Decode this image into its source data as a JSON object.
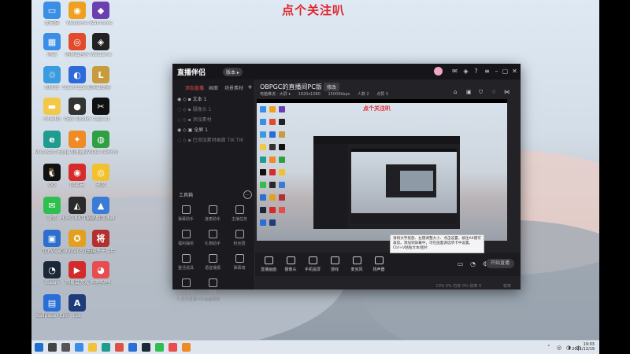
{
  "banner": "点个关注叭",
  "desktop_icons": [
    {
      "label": "此电脑",
      "color": "#3a8ee6",
      "glyph": "▭"
    },
    {
      "label": "WeGame",
      "color": "#f0a020",
      "glyph": "◉"
    },
    {
      "label": "Warframe",
      "color": "#6b3fb0",
      "glyph": "◆"
    },
    {
      "label": "网络",
      "color": "#3a8ee6",
      "glyph": "▦"
    },
    {
      "label": "网易云音乐",
      "color": "#e24a2b",
      "glyph": "◎"
    },
    {
      "label": "WeGame",
      "color": "#222",
      "glyph": "◈"
    },
    {
      "label": "回收站",
      "color": "#3a9be0",
      "glyph": "♲"
    },
    {
      "label": "SteamSpeed",
      "color": "#2f6bd8",
      "glyph": "◐"
    },
    {
      "label": "英雄联盟",
      "color": "#c89b3c",
      "glyph": "L"
    },
    {
      "label": "mhwlib",
      "color": "#f3c84a",
      "glyph": "▬"
    },
    {
      "label": "OBS Studio",
      "color": "#333",
      "glyph": "●"
    },
    {
      "label": "CapCut",
      "color": "#111",
      "glyph": "✂"
    },
    {
      "label": "Microsoft Edge",
      "color": "#1f9c8f",
      "glyph": "e"
    },
    {
      "label": "加速器",
      "color": "#f08a24",
      "glyph": "✦"
    },
    {
      "label": "NVIDIA GeForce",
      "color": "#2ea043",
      "glyph": "◍"
    },
    {
      "label": "QQ",
      "color": "#111",
      "glyph": "🐧"
    },
    {
      "label": "网易云",
      "color": "#d62b2b",
      "glyph": "◉"
    },
    {
      "label": "迅游",
      "color": "#f2c12e",
      "glyph": "◎"
    },
    {
      "label": "微信",
      "color": "#2fbf4f",
      "glyph": "✉"
    },
    {
      "label": "PUBG BATTLEGR...",
      "color": "#2a2a2a",
      "glyph": "◭"
    },
    {
      "label": "Win版加速器",
      "color": "#3a7bd5",
      "glyph": "▲"
    },
    {
      "label": "TCPView",
      "color": "#2d6fcf",
      "glyph": "▣"
    },
    {
      "label": "Counter-Strike Global Off...",
      "color": "#e2a020",
      "glyph": "✪"
    },
    {
      "label": "三国杀十周年",
      "color": "#b23030",
      "glyph": "将"
    },
    {
      "label": "Steam",
      "color": "#1b2838",
      "glyph": "◔"
    },
    {
      "label": "网易云游戏",
      "color": "#d32a2a",
      "glyph": "▶"
    },
    {
      "label": "哔哩哔哩",
      "color": "#e84c50",
      "glyph": "◕"
    },
    {
      "label": "Wallpaper Engine",
      "color": "#2a6fd6",
      "glyph": "▤"
    },
    {
      "label": "LoL",
      "color": "#1f3c7a",
      "glyph": "A"
    }
  ],
  "app": {
    "logo": "直播伴侣",
    "version": "版本 ▸",
    "left_tabs": [
      "添加直播",
      "画面",
      "场景素材"
    ],
    "sources": [
      {
        "name": "文本 1",
        "state": "visible"
      },
      {
        "name": "摄像头 1",
        "state": "hidden"
      },
      {
        "name": "添加素材",
        "state": "hidden"
      },
      {
        "name": "全屏 1",
        "state": "visible"
      },
      {
        "name": "已添加素材画面 TIK TIK",
        "state": "hidden"
      }
    ],
    "tools_header": "工具箱",
    "tools": [
      "弹幕助手",
      "连麦助手",
      "主播任务",
      "福利抽奖",
      "礼物助手",
      "粉丝团",
      "整活道具",
      "语音播报",
      "弹幕墙",
      "表情播报",
      "更多"
    ],
    "bottom_note": "5.显示直播中的画面模板",
    "room_title": "OBPGC的直播间PC版",
    "room_button": "修改",
    "meta": [
      "电脑推流 · 大屏 ▾",
      "1920x1080",
      "15000kbps",
      "人数 2",
      "点赞 3"
    ],
    "ctrl_buttons": [
      "直播画面",
      "摄像头",
      "手机投屏",
      "游戏",
      "麦克风",
      "扬声器"
    ],
    "start_live": "开始直播",
    "status_left": "CPU 0%  内存 0%  帧率 0",
    "status_right": "帧率"
  },
  "tooltip": "请将文字拖放、左键调整大小、点击设置，按住Alt键可裁剪。添加到屏幕中，可在画面源选项卡中设置。Ctrl+V粘贴文本/图片",
  "taskbar": {
    "apps": [
      "windows",
      "search",
      "task-view",
      "widgets",
      "explorer",
      "edge",
      "chrome",
      "store",
      "steam",
      "wechat",
      "bilibili",
      "app"
    ],
    "time": "19:03",
    "date": "2021/12/19"
  }
}
